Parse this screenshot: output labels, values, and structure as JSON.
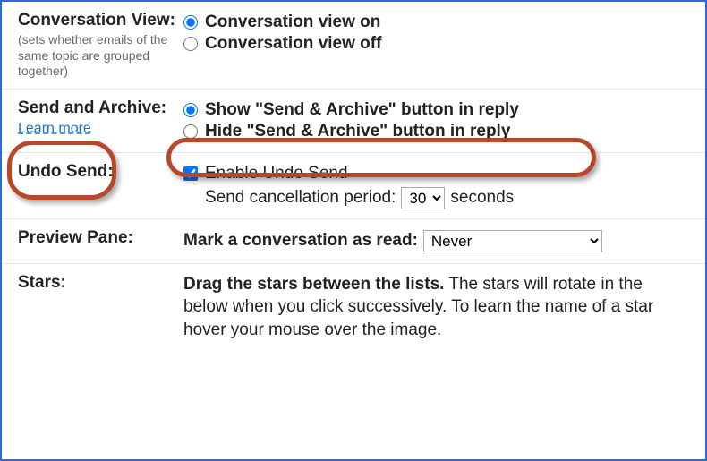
{
  "conversation_view": {
    "heading": "Conversation View:",
    "hint": "(sets whether emails of the same topic are grouped together)",
    "options": {
      "on": "Conversation view on",
      "off": "Conversation view off"
    },
    "selected": "on"
  },
  "send_archive": {
    "heading": "Send and Archive:",
    "learn_more": "Learn more",
    "options": {
      "show": "Show \"Send & Archive\" button in reply",
      "hide": "Hide \"Send & Archive\" button in reply"
    },
    "selected": "show"
  },
  "undo_send": {
    "heading": "Undo Send:",
    "enable_label": "Enable Undo Send",
    "enabled": true,
    "period_label_before": "Send cancellation period:",
    "period_value": "30",
    "period_label_after": "seconds"
  },
  "preview_pane": {
    "heading": "Preview Pane:",
    "mark_label": "Mark a conversation as read:",
    "selected": "Never"
  },
  "stars": {
    "heading": "Stars:",
    "text_bold": "Drag the stars between the lists.",
    "text_rest": " The stars will rotate in the below when you click successively. To learn the name of a star hover your mouse over the image."
  }
}
